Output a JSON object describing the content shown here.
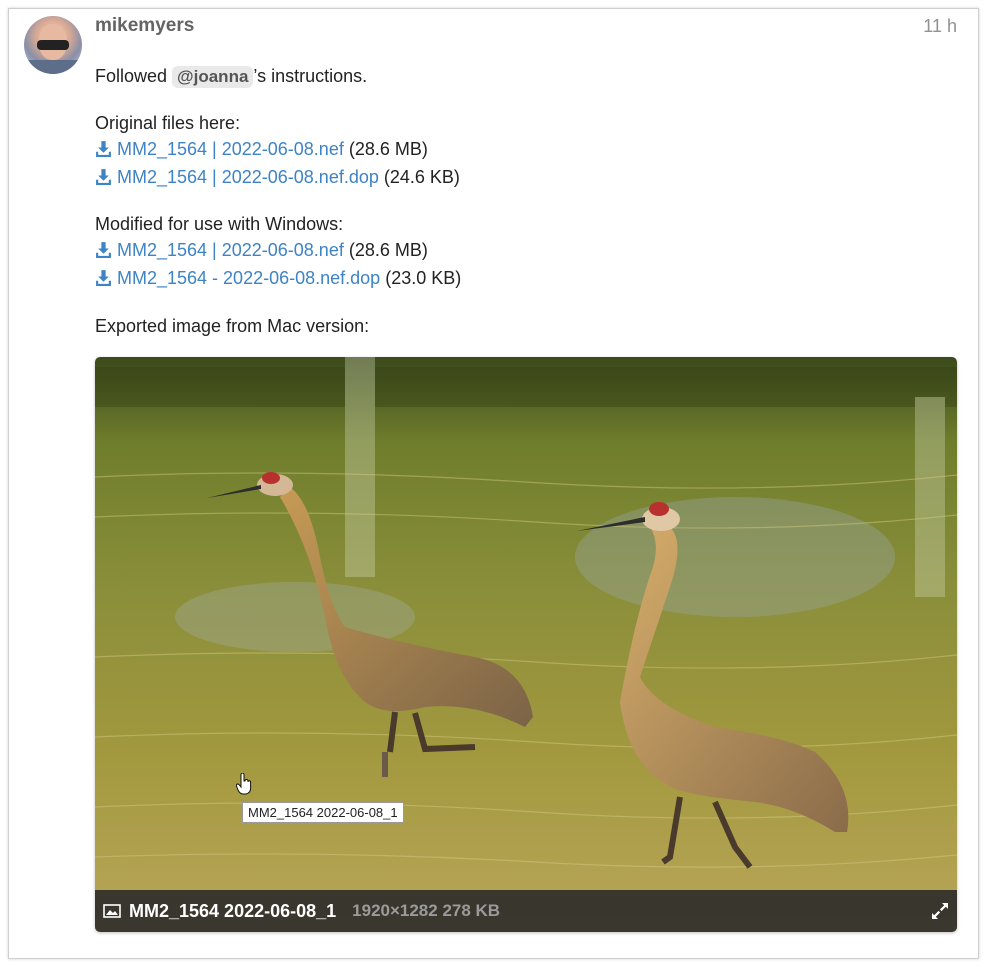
{
  "post": {
    "username": "mikemyers",
    "time": "11 h",
    "intro_before": "Followed ",
    "mention": "@joanna",
    "intro_after": "’s instructions.",
    "original_heading": "Original files here:",
    "modified_heading": "Modified for use with Windows:",
    "exported_heading": "Exported image from Mac version:"
  },
  "original_files": [
    {
      "name": "MM2_1564 | 2022-06-08.nef",
      "size": "(28.6 MB)"
    },
    {
      "name": "MM2_1564 | 2022-06-08.nef.dop",
      "size": "(24.6 KB)"
    }
  ],
  "modified_files": [
    {
      "name": "MM2_1564 | 2022-06-08.nef",
      "size": "(28.6 MB)"
    },
    {
      "name": "MM2_1564 - 2022-06-08.nef.dop",
      "size": "(23.0 KB)"
    }
  ],
  "image": {
    "caption_name": "MM2_1564 2022-06-08_1",
    "caption_meta": "1920×1282 278 KB",
    "tooltip": "MM2_1564  2022-06-08_1"
  },
  "icons": {
    "download": "download-icon",
    "image": "image-icon",
    "expand": "expand-icon"
  },
  "colors": {
    "link": "#3d83c6",
    "username": "#646464",
    "timestamp": "#919191"
  }
}
